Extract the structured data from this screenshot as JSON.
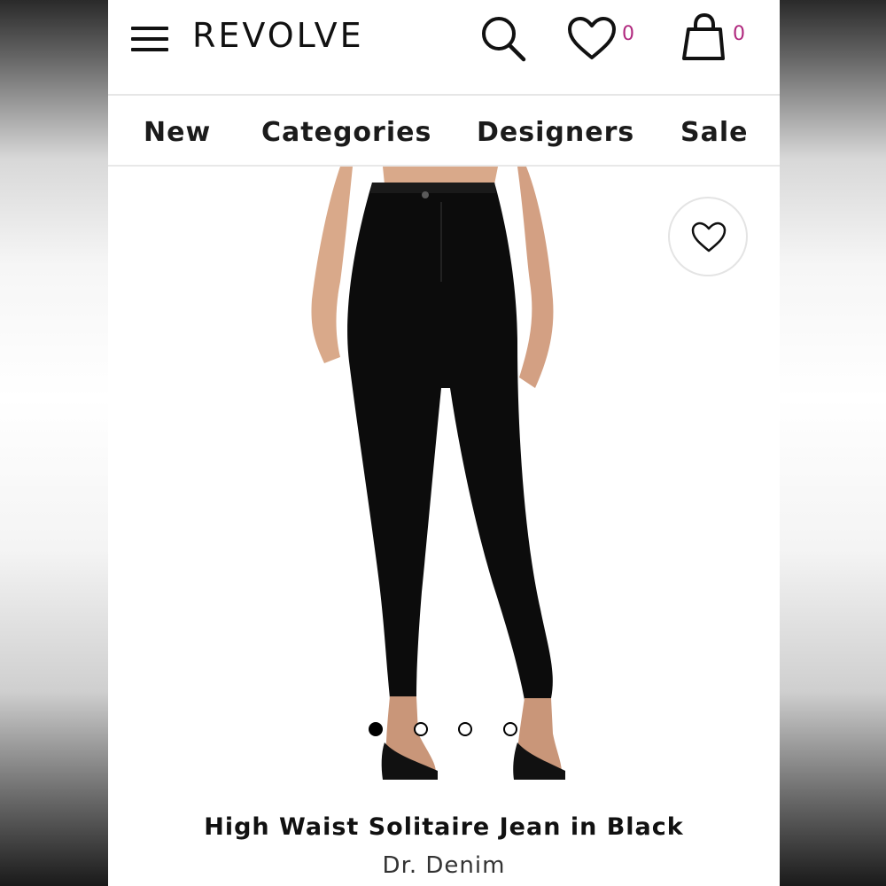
{
  "header": {
    "logo": "REVOLVE",
    "wishlist_count": "0",
    "bag_count": "0",
    "count_color": "#b0287e"
  },
  "nav": {
    "items": [
      {
        "label": "New"
      },
      {
        "label": "Categories"
      },
      {
        "label": "Designers"
      },
      {
        "label": "Sale"
      }
    ]
  },
  "product": {
    "title": "High Waist Solitaire Jean in Black",
    "brand": "Dr. Denim",
    "image_count": 4,
    "active_image": 1
  },
  "icons": {
    "menu": "hamburger-menu-icon",
    "search": "search-icon",
    "wishlist": "heart-icon",
    "bag": "shopping-bag-icon",
    "favorite": "heart-outline-icon"
  }
}
